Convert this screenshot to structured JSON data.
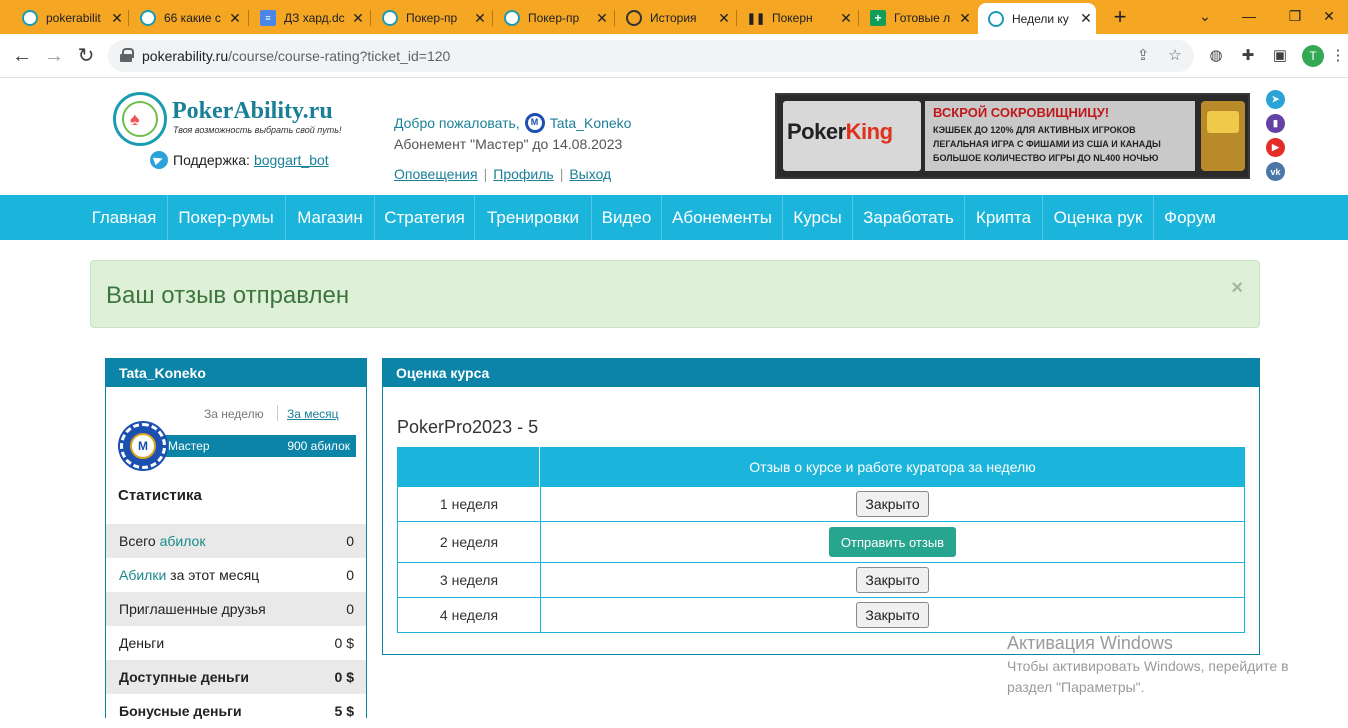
{
  "browser": {
    "tabs": [
      {
        "title": "pokerabilit",
        "icon": "poker-icon"
      },
      {
        "title": "66 какие с",
        "icon": "poker-icon"
      },
      {
        "title": "ДЗ хард.dc",
        "icon": "docs-icon"
      },
      {
        "title": "Покер-пр",
        "icon": "poker-icon"
      },
      {
        "title": "Покер-пр",
        "icon": "poker-icon"
      },
      {
        "title": "История",
        "icon": "history-icon"
      },
      {
        "title": "Покерн",
        "icon": "pause-icon"
      },
      {
        "title": "Готовые л",
        "icon": "sheets-icon"
      },
      {
        "title": "Недели ку",
        "icon": "poker-icon"
      }
    ],
    "address": {
      "host": "pokerability.ru",
      "path": "/course/course-rating?ticket_id=120"
    },
    "profile_initial": "T"
  },
  "header": {
    "brand": "PokerAbility.ru",
    "tagline": "Твоя возможность выбрать свой путь!",
    "support_label": "Поддержка:",
    "support_link": "boggart_bot",
    "welcome": "Добро пожаловать,",
    "username": "Tata_Koneko",
    "subscription": "Абонемент \"Мастер\" до 14.08.2023",
    "links": [
      "Оповещения",
      "Профиль",
      "Выход"
    ],
    "separator": "|",
    "banner": {
      "logo_poker": "Poker",
      "logo_king": "King",
      "headline": "ВСКРОЙ СОКРОВИЩНИЦУ!",
      "lines": [
        "КЭШБЕК ДО 120% ДЛЯ АКТИВНЫХ ИГРОКОВ",
        "ЛЕГАЛЬНАЯ ИГРА С ФИШАМИ ИЗ США И КАНАДЫ",
        "БОЛЬШОЕ КОЛИЧЕСТВО ИГРЫ ДО NL400 НОЧЬЮ"
      ]
    }
  },
  "nav": [
    "Главная",
    "Покер-румы",
    "Магазин",
    "Стратегия",
    "Тренировки",
    "Видео",
    "Абонементы",
    "Курсы",
    "Заработать",
    "Крипта",
    "Оценка рук",
    "Форум"
  ],
  "alert": {
    "message": "Ваш отзыв отправлен",
    "close": "×"
  },
  "sidebar": {
    "username": "Tata_Koneko",
    "period_week": "За неделю",
    "period_month": "За месяц",
    "level_chip": "M",
    "level": "Мастер",
    "points": "900 абилок",
    "stats_title": "Статистика",
    "stats": [
      {
        "pre": "Всего ",
        "hl": "абилок",
        "post": "",
        "value": "0"
      },
      {
        "pre": "",
        "hl": "Абилки",
        "post": " за этот месяц",
        "value": "0"
      },
      {
        "pre": "Приглашенные друзья",
        "hl": "",
        "post": "",
        "value": "0"
      },
      {
        "pre": "Деньги",
        "hl": "",
        "post": "",
        "value": "0 $"
      },
      {
        "pre": "Доступные деньги",
        "hl": "",
        "post": "",
        "value": "0 $"
      },
      {
        "pre": "Бонусные деньги",
        "hl": "",
        "post": "",
        "value": "5 $"
      }
    ]
  },
  "rating": {
    "panel_title": "Оценка курса",
    "course": "PokerPro2023 - 5",
    "column_header": "Отзыв о курсе и работе куратора за неделю",
    "rows": [
      {
        "week": "1 неделя",
        "action": "Закрыто",
        "type": "closed"
      },
      {
        "week": "2 неделя",
        "action": "Отправить отзыв",
        "type": "send"
      },
      {
        "week": "3 неделя",
        "action": "Закрыто",
        "type": "closed"
      },
      {
        "week": "4 неделя",
        "action": "Закрыто",
        "type": "closed"
      }
    ]
  },
  "watermark": {
    "title": "Активация Windows",
    "line1": "Чтобы активировать Windows, перейдите в",
    "line2": "раздел \"Параметры\"."
  },
  "colors": {
    "nav": "#1bb5dc",
    "panel_head": "#0c84a8",
    "send_button": "#27a58f",
    "tabbar": "#f5a623"
  }
}
